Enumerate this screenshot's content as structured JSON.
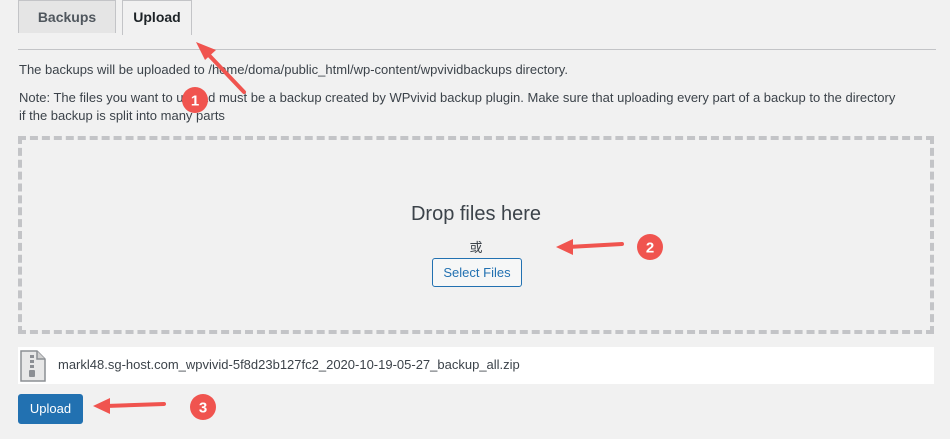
{
  "tabs": [
    {
      "label": "Backups",
      "active": false
    },
    {
      "label": "Upload",
      "active": true
    }
  ],
  "info": {
    "upload_location": "The backups will be uploaded to /home/doma/public_html/wp-content/wpvividbackups directory.",
    "note_line1": "Note: The files you want to upload must be a backup created by WPvivid backup plugin. Make sure that uploading every part of a backup to the directory",
    "note_line2": "if the backup is split into many parts"
  },
  "dropzone": {
    "title": "Drop files here",
    "or_text": "或",
    "select_button": "Select Files"
  },
  "file": {
    "name": "markl48.sg-host.com_wpvivid-5f8d23b127fc2_2020-10-19-05-27_backup_all.zip",
    "icon": "zip-file-icon"
  },
  "actions": {
    "upload_button": "Upload"
  },
  "annotations": {
    "color": "#f0544f",
    "markers": [
      "1",
      "2",
      "3"
    ]
  }
}
